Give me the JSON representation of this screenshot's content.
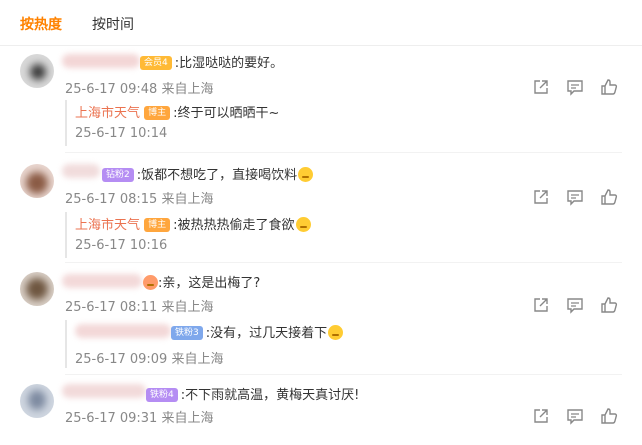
{
  "tabs": {
    "hot": "按热度",
    "time": "按时间"
  },
  "colors": {
    "accent": "#ff8200",
    "reply_name": "#eb7350",
    "meta": "#888888"
  },
  "comments": [
    {
      "badge": "会员4",
      "text": ":比湿哒哒的要好。",
      "meta": "25-6-17 09:48 来自上海",
      "reply": {
        "name": "上海市天气",
        "badge": "博主",
        "text": ":终于可以晒晒干~",
        "meta": "25-6-17 10:14"
      }
    },
    {
      "badge": "钻粉2",
      "text": ":饭都不想吃了，直接喝饮料",
      "meta": "25-6-17 08:15 来自上海",
      "reply": {
        "name": "上海市天气",
        "badge": "博主",
        "text": ":被热热热偷走了食欲",
        "meta": "25-6-17 10:16"
      }
    },
    {
      "badge": "",
      "text": ":亲，这是出梅了?",
      "meta": "25-6-17 08:11 来自上海",
      "reply": {
        "name": "",
        "badge": "铁粉3",
        "text": ":没有，过几天接着下",
        "meta": "25-6-17 09:09 来自上海"
      }
    },
    {
      "badge": "铁粉4",
      "text": ":不下雨就高温，黄梅天真讨厌!",
      "meta": "25-6-17 09:31 来自上海"
    }
  ],
  "icons": {
    "share": "share-icon",
    "comment": "comment-icon",
    "like": "thumbs-up-icon"
  }
}
